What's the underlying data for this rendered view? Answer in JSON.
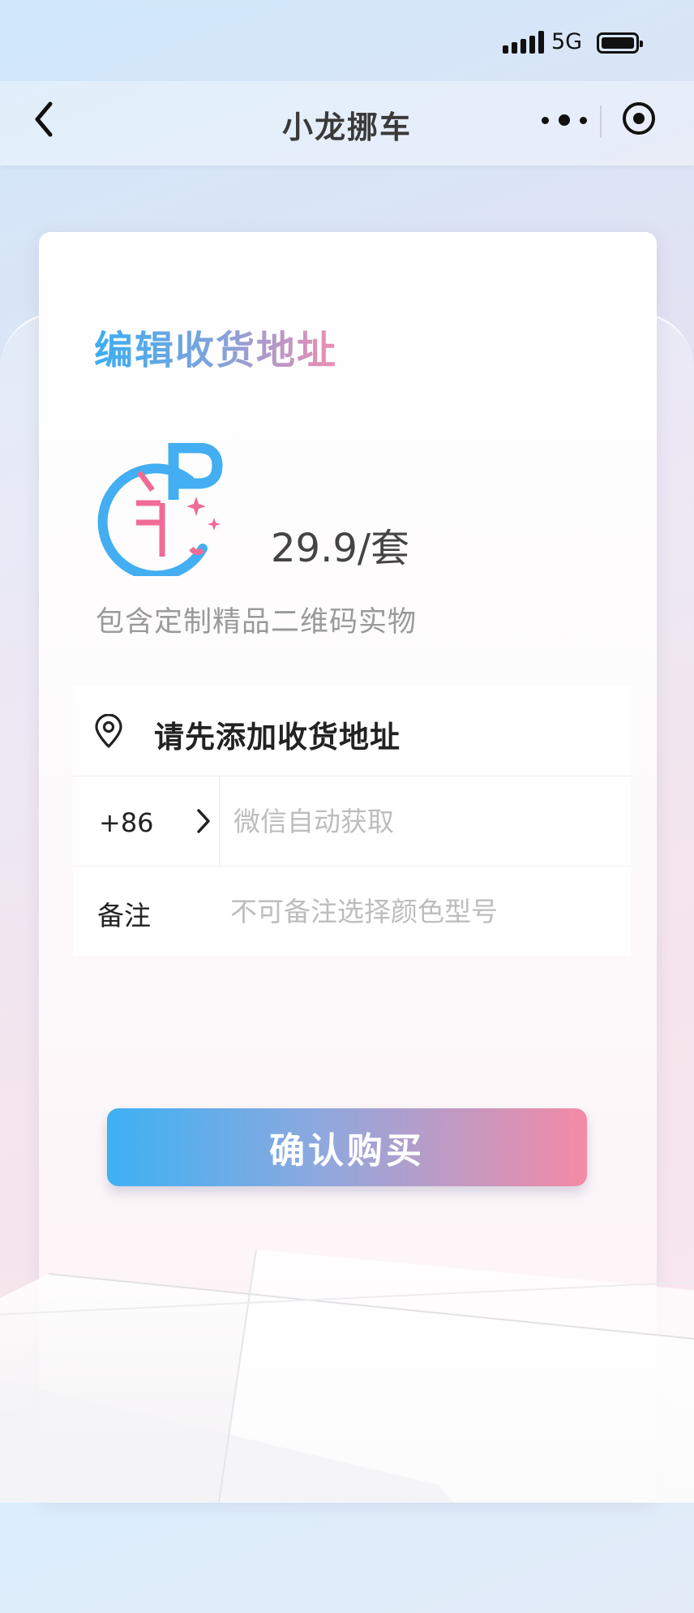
{
  "status_bar": {
    "network": "5G"
  },
  "nav": {
    "title": "小龙挪车"
  },
  "card": {
    "section_title": "编辑收货地址",
    "price": "29.9/套",
    "description": "包含定制精品二维码实物"
  },
  "form": {
    "address_prompt": "请先添加收货地址",
    "country_code": "+86",
    "phone_placeholder": "微信自动获取",
    "note_label": "备注",
    "note_placeholder": "不可备注选择颜色型号"
  },
  "actions": {
    "confirm_label": "确认购买"
  },
  "colors": {
    "accent_blue": "#3db1f3",
    "accent_pink": "#f48aa6",
    "text_dark": "#222222",
    "placeholder": "#bdbdbd"
  },
  "icons": [
    "back-chevron-icon",
    "more-dots-icon",
    "record-target-icon",
    "parking-logo-icon",
    "location-pin-icon",
    "chevron-right-icon",
    "signal-icon",
    "battery-icon"
  ]
}
